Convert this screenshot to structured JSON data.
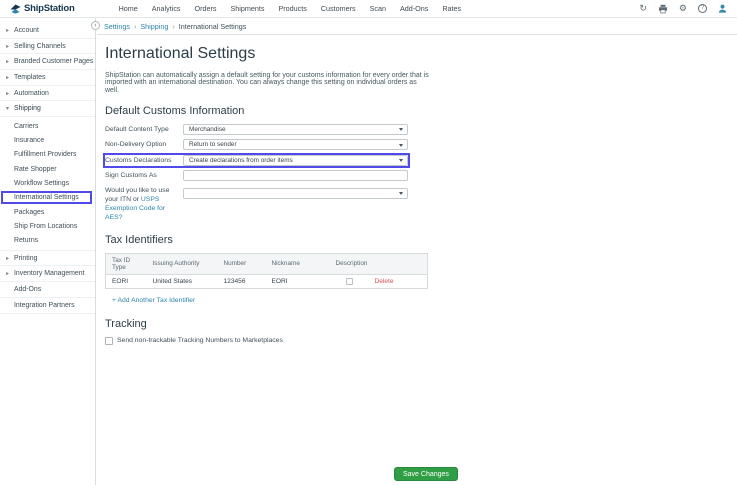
{
  "colors": {
    "brand_navy": "#16354f",
    "link_teal": "#2e86ab",
    "save_green": "#2f9e44",
    "delete_red": "#d9534f",
    "highlight_outline": "#4f4ae8"
  },
  "icons": {
    "refresh": "↻",
    "gear": "⚙",
    "help": "?",
    "collapse": "‹",
    "chevron_right": "▸",
    "chevron_down": "▾",
    "breadcrumb_sep": "›"
  },
  "navbar": {
    "brand": "ShipStation",
    "items": [
      "Home",
      "Analytics",
      "Orders",
      "Shipments",
      "Products",
      "Customers",
      "Scan",
      "Add-Ons",
      "Rates"
    ]
  },
  "breadcrumb": [
    "Settings",
    "Shipping",
    "International Settings"
  ],
  "sidebar": {
    "top_items": [
      "Account",
      "Selling Channels",
      "Branded Customer Pages",
      "Templates",
      "Automation"
    ],
    "shipping_label": "Shipping",
    "shipping_children": [
      "Carriers",
      "Insurance",
      "Fulfillment Providers",
      "Rate Shopper",
      "Workflow Settings",
      "International Settings",
      "Packages",
      "Ship From Locations",
      "Returns"
    ],
    "bottom_items": [
      "Printing",
      "Inventory Management",
      "Add-Ons",
      "Integration Partners"
    ]
  },
  "main": {
    "title": "International Settings",
    "intro_lines": [
      "ShipStation can automatically assign a default setting for your customs information for every order that is",
      "imported with an international destination. You can always change this setting on individual orders as",
      "well."
    ],
    "customs": {
      "heading": "Default Customs Information",
      "fields": [
        {
          "label": "Default Content Type",
          "value": "Merchandise"
        },
        {
          "label": "Non-Delivery Option",
          "value": "Return to sender"
        },
        {
          "label": "Customs Declarations",
          "value": "Create declarations from order items"
        },
        {
          "label": "Sign Customs As",
          "value": ""
        },
        {
          "label_pre": "Would you like to use your ITN or ",
          "link": "USPS Exemption Code for AES?",
          "value": ""
        }
      ]
    },
    "tax": {
      "heading": "Tax Identifiers",
      "headers": [
        "Tax ID Type",
        "Issuing Authority",
        "Number",
        "Nickname",
        "Description"
      ],
      "rows": [
        {
          "tax_id_type": "EORI",
          "issuing_authority": "United States",
          "number": "123456",
          "nickname": "EORI",
          "delete_label": "Delete"
        }
      ],
      "add_link": "+ Add Another Tax Identifier"
    },
    "tracking": {
      "heading": "Tracking",
      "checkbox_label": "Send non-trackable Tracking Numbers to Marketplaces"
    },
    "save_button": "Save Changes"
  }
}
